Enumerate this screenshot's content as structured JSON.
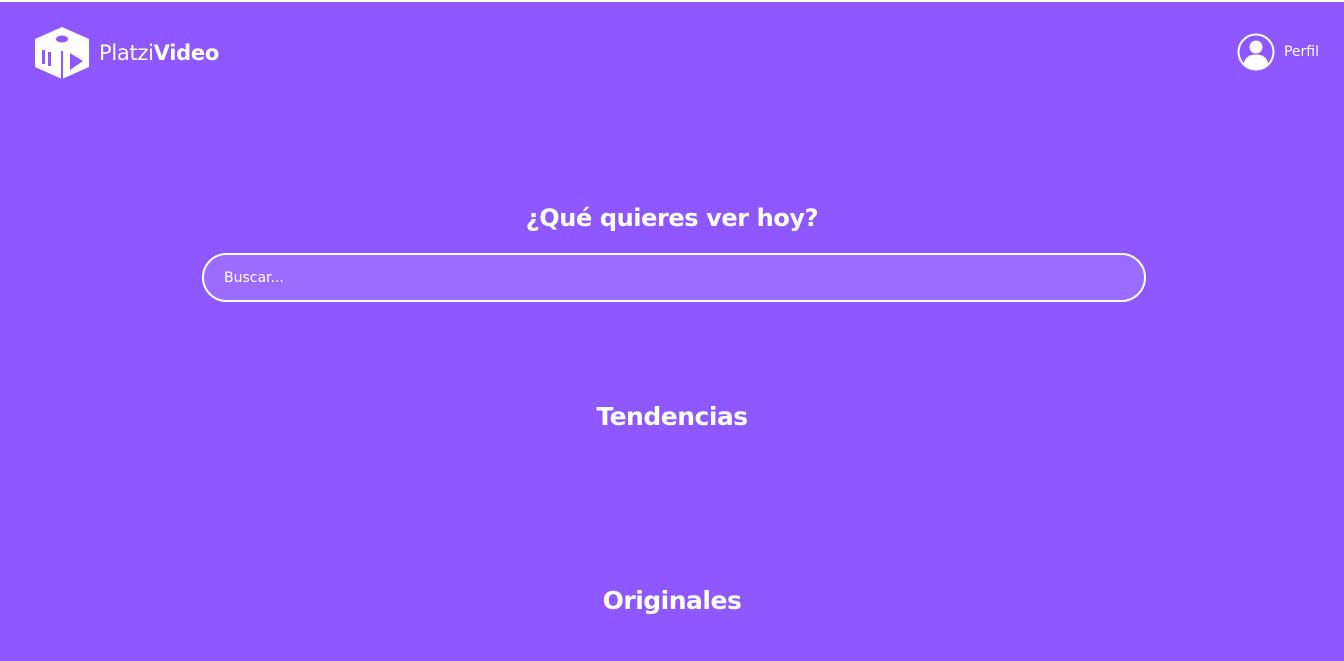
{
  "header": {
    "logo": {
      "text_light": "Platzi",
      "text_bold": "Video",
      "icon": "cube-play-logo-icon"
    },
    "profile": {
      "label": "Perfil",
      "icon": "user-avatar-icon"
    }
  },
  "search": {
    "title": "¿Qué quieres ver hoy?",
    "placeholder": "Buscar...",
    "value": ""
  },
  "sections": [
    {
      "title": "Tendencias"
    },
    {
      "title": "Originales"
    }
  ],
  "colors": {
    "background": "#8f57ff",
    "text": "#ffffff"
  }
}
